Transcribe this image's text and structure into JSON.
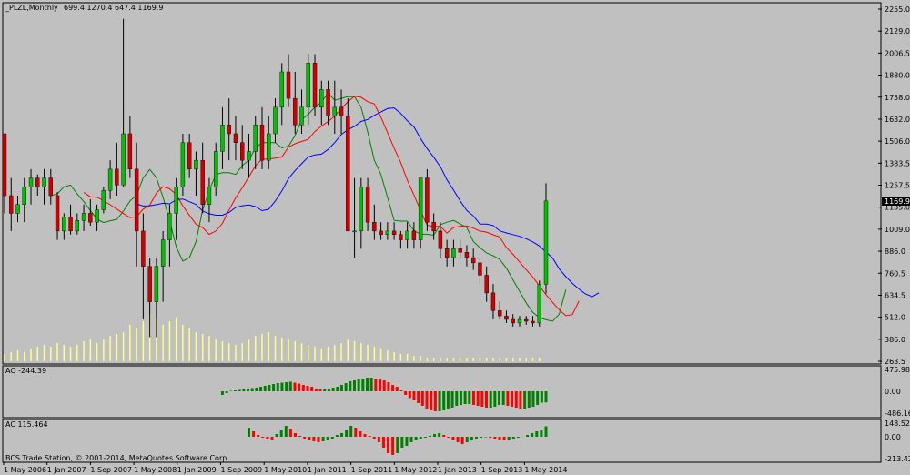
{
  "window": {
    "symbol_title": "_PLZL,Monthly",
    "ohlc_values": "699.4 1270.4 647.4 1169.9",
    "current_price_tag": "1169.9",
    "footer": "BCS Trade Station, © 2001-2014, MetaQuotes Software Corp."
  },
  "colors": {
    "background": "#c0c0c0",
    "bull": "#00c000",
    "bear": "#d00000",
    "wick": "#000000",
    "volume": "#ffff80",
    "ma_fast": "#008000",
    "ma_mid": "#ff0000",
    "ma_slow": "#0000ff",
    "ao_up": "#008000",
    "ao_down": "#ff0000"
  },
  "price_axis": {
    "ticks": [
      "2255.0",
      "2129.0",
      "2006.5",
      "1880.0",
      "1758.0",
      "1632.0",
      "1506.0",
      "1383.5",
      "1257.5",
      "1135.0",
      "1009.0",
      "886.0",
      "760.5",
      "634.5",
      "512.0",
      "386.0",
      "263.5"
    ]
  },
  "ao_panel": {
    "label": "AO -244.39",
    "ticks": [
      "475.98",
      "0.00",
      "-486.16"
    ]
  },
  "ac_panel": {
    "label": "AC 115.464",
    "ticks": [
      "148.528",
      "0.00",
      "-213.428"
    ]
  },
  "time_axis": {
    "labels": [
      "1 May 2006",
      "1 Jan 2007",
      "1 Sep 2007",
      "1 May 2008",
      "1 Jan 2009",
      "1 Sep 2009",
      "1 May 2010",
      "1 Jan 2011",
      "1 Sep 2011",
      "1 May 2012",
      "1 Jan 2013",
      "1 Sep 2013",
      "1 May 2014"
    ]
  },
  "chart_data": {
    "type": "candlestick",
    "title": "_PLZL,Monthly",
    "ylim": [
      263.5,
      2255.0
    ],
    "candles": [
      [
        1550,
        1550,
        1100,
        1200
      ],
      [
        1200,
        1300,
        1000,
        1100
      ],
      [
        1100,
        1200,
        1050,
        1150
      ],
      [
        1150,
        1300,
        1050,
        1250
      ],
      [
        1250,
        1350,
        1150,
        1300
      ],
      [
        1300,
        1320,
        1200,
        1250
      ],
      [
        1250,
        1350,
        1150,
        1300
      ],
      [
        1300,
        1350,
        1150,
        1200
      ],
      [
        1200,
        1220,
        950,
        1000
      ],
      [
        1000,
        1100,
        950,
        1080
      ],
      [
        1080,
        1150,
        980,
        1000
      ],
      [
        1000,
        1100,
        980,
        1060
      ],
      [
        1060,
        1150,
        1000,
        1100
      ],
      [
        1100,
        1180,
        1030,
        1050
      ],
      [
        1050,
        1150,
        1000,
        1120
      ],
      [
        1120,
        1250,
        1100,
        1230
      ],
      [
        1230,
        1400,
        1180,
        1350
      ],
      [
        1350,
        1500,
        1200,
        1260
      ],
      [
        1260,
        2200,
        1250,
        1550
      ],
      [
        1550,
        1650,
        1300,
        1350
      ],
      [
        1350,
        1500,
        800,
        1000
      ],
      [
        1000,
        1100,
        500,
        800
      ],
      [
        800,
        850,
        400,
        600
      ],
      [
        600,
        850,
        400,
        800
      ],
      [
        800,
        1000,
        600,
        950
      ],
      [
        950,
        1150,
        800,
        1100
      ],
      [
        1100,
        1300,
        950,
        1250
      ],
      [
        1250,
        1550,
        1200,
        1500
      ],
      [
        1500,
        1550,
        1300,
        1350
      ],
      [
        1350,
        1450,
        1200,
        1400
      ],
      [
        1400,
        1500,
        1100,
        1150
      ],
      [
        1150,
        1300,
        1050,
        1250
      ],
      [
        1250,
        1500,
        1200,
        1450
      ],
      [
        1450,
        1700,
        1350,
        1600
      ],
      [
        1600,
        1750,
        1400,
        1550
      ],
      [
        1550,
        1650,
        1400,
        1500
      ],
      [
        1500,
        1600,
        1350,
        1400
      ],
      [
        1400,
        1550,
        1300,
        1450
      ],
      [
        1450,
        1650,
        1350,
        1600
      ],
      [
        1600,
        1700,
        1350,
        1400
      ],
      [
        1400,
        1650,
        1350,
        1550
      ],
      [
        1550,
        1750,
        1500,
        1700
      ],
      [
        1700,
        1950,
        1600,
        1900
      ],
      [
        1900,
        2000,
        1700,
        1750
      ],
      [
        1750,
        1900,
        1550,
        1600
      ],
      [
        1600,
        1800,
        1550,
        1700
      ],
      [
        1700,
        2000,
        1600,
        1950
      ],
      [
        1950,
        2000,
        1650,
        1700
      ],
      [
        1700,
        1850,
        1600,
        1800
      ],
      [
        1800,
        1850,
        1600,
        1650
      ],
      [
        1650,
        1850,
        1550,
        1700
      ],
      [
        1700,
        1800,
        1550,
        1650
      ],
      [
        1650,
        1750,
        1000,
        1000
      ],
      [
        1000,
        1300,
        850,
        1000
      ],
      [
        1000,
        1300,
        900,
        1250
      ],
      [
        1250,
        1300,
        1000,
        1050
      ],
      [
        1050,
        1150,
        950,
        1000
      ],
      [
        1000,
        1050,
        950,
        980
      ],
      [
        980,
        1050,
        950,
        1000
      ],
      [
        1000,
        1050,
        950,
        980
      ],
      [
        980,
        1000,
        900,
        950
      ],
      [
        950,
        1050,
        900,
        1000
      ],
      [
        1000,
        1050,
        900,
        950
      ],
      [
        950,
        1300,
        900,
        1300
      ],
      [
        1300,
        1350,
        1000,
        1050
      ],
      [
        1050,
        1100,
        950,
        1000
      ],
      [
        1000,
        1050,
        850,
        900
      ],
      [
        900,
        950,
        800,
        850
      ],
      [
        850,
        950,
        800,
        900
      ],
      [
        900,
        950,
        850,
        880
      ],
      [
        880,
        920,
        800,
        850
      ],
      [
        850,
        900,
        780,
        820
      ],
      [
        820,
        850,
        700,
        750
      ],
      [
        750,
        800,
        600,
        650
      ],
      [
        650,
        700,
        500,
        550
      ],
      [
        550,
        600,
        500,
        520
      ],
      [
        520,
        550,
        480,
        500
      ],
      [
        500,
        530,
        460,
        480
      ],
      [
        480,
        520,
        460,
        500
      ],
      [
        500,
        520,
        470,
        490
      ],
      [
        490,
        520,
        460,
        480
      ],
      [
        480,
        720,
        460,
        699
      ],
      [
        699,
        1270,
        647,
        1170
      ]
    ],
    "volume": [
      4,
      5,
      6,
      5,
      7,
      8,
      9,
      8,
      10,
      9,
      8,
      9,
      11,
      12,
      10,
      12,
      14,
      15,
      16,
      20,
      18,
      22,
      26,
      24,
      20,
      22,
      24,
      20,
      18,
      16,
      15,
      14,
      12,
      11,
      10,
      9,
      10,
      12,
      14,
      15,
      16,
      14,
      13,
      12,
      11,
      10,
      9,
      8,
      7,
      8,
      9,
      10,
      12,
      11,
      10,
      9,
      8,
      7,
      6,
      5,
      4,
      4,
      3,
      3,
      2,
      2,
      2,
      2,
      2,
      2,
      2,
      2,
      2,
      2,
      2,
      2,
      2,
      2,
      2,
      2,
      2,
      2
    ],
    "ao": [
      -80,
      -40,
      10,
      20,
      30,
      40,
      60,
      70,
      80,
      100,
      120,
      140,
      160,
      180,
      190,
      200,
      210,
      190,
      170,
      140,
      120,
      100,
      60,
      40,
      50,
      60,
      80,
      100,
      140,
      180,
      220,
      240,
      260,
      280,
      300,
      300,
      280,
      260,
      240,
      200,
      140,
      100,
      20,
      -80,
      -150,
      -200,
      -260,
      -320,
      -380,
      -420,
      -440,
      -440,
      -420,
      -400,
      -360,
      -320,
      -300,
      -280,
      -280,
      -300,
      -320,
      -340,
      -360,
      -360,
      -340,
      -300,
      -300,
      -320,
      -340,
      -360,
      -380,
      -380,
      -360,
      -340,
      -300,
      -250,
      -244
    ],
    "ac": [
      100,
      60,
      20,
      -10,
      -20,
      -30,
      30,
      80,
      120,
      90,
      40,
      10,
      -20,
      -40,
      -50,
      -60,
      -50,
      -40,
      -20,
      20,
      40,
      80,
      120,
      100,
      60,
      30,
      10,
      -20,
      -60,
      -120,
      -180,
      -200,
      -180,
      -120,
      -100,
      -60,
      -40,
      -20,
      -10,
      10,
      30,
      40,
      20,
      -10,
      -40,
      -60,
      -80,
      -60,
      -40,
      -20,
      -10,
      -5,
      -10,
      -20,
      -30,
      -40,
      -30,
      -20,
      -10,
      0,
      20,
      40,
      60,
      80,
      115
    ]
  }
}
